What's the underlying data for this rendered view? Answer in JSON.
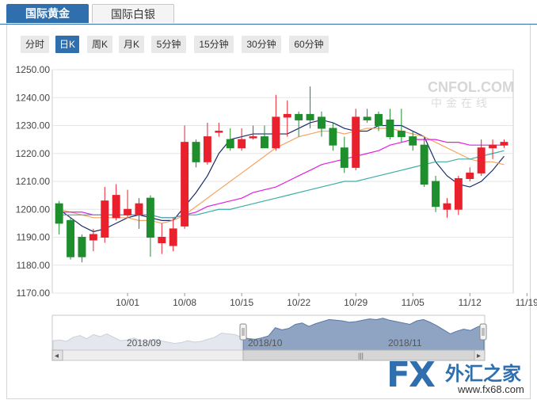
{
  "tabs": [
    {
      "label": "国际黄金",
      "active": true
    },
    {
      "label": "国际白银",
      "active": false
    }
  ],
  "periods": [
    {
      "label": "分时",
      "active": false
    },
    {
      "label": "日K",
      "active": true
    },
    {
      "label": "周K",
      "active": false
    },
    {
      "label": "月K",
      "active": false
    },
    {
      "label": "5分钟",
      "active": false
    },
    {
      "label": "15分钟",
      "active": false
    },
    {
      "label": "30分钟",
      "active": false
    },
    {
      "label": "60分钟",
      "active": false
    }
  ],
  "watermark": {
    "brand": "CNFOL.COM",
    "brand_cn": "中金在线"
  },
  "logo": {
    "fx": "FX",
    "cn": "外汇之家",
    "url": "www.fx68.com"
  },
  "navigator": {
    "labels": [
      "2018/09",
      "2018/10",
      "2018/11"
    ],
    "left_arrow": "◂",
    "right_arrow": "▸",
    "grip": "|||"
  },
  "colors": {
    "up": "#e8212d",
    "down": "#1f8e2d",
    "ma5": "#1c2a6b",
    "ma10": "#f4a460",
    "ma20": "#e020e0",
    "ma30": "#3aaea8",
    "accent": "#2f6fae"
  },
  "chart_data": {
    "type": "candlestick",
    "title": "",
    "ylim": [
      1170,
      1250
    ],
    "y_ticks": [
      1250.0,
      1240.0,
      1230.0,
      1220.0,
      1210.0,
      1200.0,
      1190.0,
      1180.0,
      1170.0
    ],
    "x_tick_labels": [
      "10/01",
      "10/08",
      "10/15",
      "10/22",
      "10/29",
      "11/05",
      "11/12",
      "11/19"
    ],
    "x_tick_index": [
      6,
      11,
      16,
      21,
      26,
      31,
      36,
      41
    ],
    "candles": [
      {
        "o": 1202,
        "h": 1203,
        "l": 1191,
        "c": 1195
      },
      {
        "o": 1196,
        "h": 1197,
        "l": 1182,
        "c": 1183
      },
      {
        "o": 1190,
        "h": 1191,
        "l": 1181,
        "c": 1183
      },
      {
        "o": 1189,
        "h": 1193,
        "l": 1185,
        "c": 1191
      },
      {
        "o": 1190,
        "h": 1208,
        "l": 1188,
        "c": 1203
      },
      {
        "o": 1197,
        "h": 1209,
        "l": 1196,
        "c": 1205
      },
      {
        "o": 1198,
        "h": 1207,
        "l": 1197,
        "c": 1200
      },
      {
        "o": 1198,
        "h": 1204,
        "l": 1193,
        "c": 1202
      },
      {
        "o": 1204,
        "h": 1205,
        "l": 1183,
        "c": 1190
      },
      {
        "o": 1188,
        "h": 1195,
        "l": 1184,
        "c": 1190
      },
      {
        "o": 1187,
        "h": 1197,
        "l": 1185,
        "c": 1193
      },
      {
        "o": 1194,
        "h": 1230,
        "l": 1193,
        "c": 1224
      },
      {
        "o": 1224,
        "h": 1225,
        "l": 1215,
        "c": 1217
      },
      {
        "o": 1217,
        "h": 1231,
        "l": 1216,
        "c": 1226
      },
      {
        "o": 1228,
        "h": 1231,
        "l": 1226,
        "c": 1228
      },
      {
        "o": 1225,
        "h": 1229,
        "l": 1221,
        "c": 1222
      },
      {
        "o": 1222,
        "h": 1229,
        "l": 1221,
        "c": 1225
      },
      {
        "o": 1226,
        "h": 1230,
        "l": 1225,
        "c": 1226
      },
      {
        "o": 1226,
        "h": 1230,
        "l": 1222,
        "c": 1222
      },
      {
        "o": 1222,
        "h": 1241,
        "l": 1221,
        "c": 1233
      },
      {
        "o": 1233,
        "h": 1239,
        "l": 1226,
        "c": 1234
      },
      {
        "o": 1234,
        "h": 1235,
        "l": 1226,
        "c": 1232
      },
      {
        "o": 1234,
        "h": 1244,
        "l": 1229,
        "c": 1232
      },
      {
        "o": 1233,
        "h": 1235,
        "l": 1226,
        "c": 1229
      },
      {
        "o": 1229,
        "h": 1231,
        "l": 1221,
        "c": 1223
      },
      {
        "o": 1222,
        "h": 1226,
        "l": 1213,
        "c": 1215
      },
      {
        "o": 1215,
        "h": 1236,
        "l": 1214,
        "c": 1233
      },
      {
        "o": 1233,
        "h": 1236,
        "l": 1231,
        "c": 1232
      },
      {
        "o": 1234,
        "h": 1235,
        "l": 1228,
        "c": 1230
      },
      {
        "o": 1232,
        "h": 1236,
        "l": 1225,
        "c": 1226
      },
      {
        "o": 1228,
        "h": 1236,
        "l": 1224,
        "c": 1226
      },
      {
        "o": 1226,
        "h": 1228,
        "l": 1221,
        "c": 1223
      },
      {
        "o": 1223,
        "h": 1226,
        "l": 1208,
        "c": 1209
      },
      {
        "o": 1210,
        "h": 1212,
        "l": 1199,
        "c": 1201
      },
      {
        "o": 1200,
        "h": 1204,
        "l": 1197,
        "c": 1202
      },
      {
        "o": 1200,
        "h": 1212,
        "l": 1198,
        "c": 1211
      },
      {
        "o": 1211,
        "h": 1215,
        "l": 1210,
        "c": 1213
      },
      {
        "o": 1213,
        "h": 1225,
        "l": 1212,
        "c": 1222
      },
      {
        "o": 1222,
        "h": 1225,
        "l": 1218,
        "c": 1223
      },
      {
        "o": 1223,
        "h": 1225,
        "l": 1222,
        "c": 1224
      }
    ],
    "ma_series": [
      {
        "key": "ma5",
        "values": [
          1200,
          1197,
          1194,
          1192,
          1193,
          1195,
          1197,
          1198,
          1197,
          1196,
          1196,
          1201,
          1206,
          1212,
          1220,
          1225,
          1226,
          1227,
          1227,
          1227,
          1227,
          1229,
          1231,
          1232,
          1231,
          1229,
          1228,
          1228,
          1230,
          1230,
          1230,
          1228,
          1226,
          1217,
          1212,
          1209,
          1208,
          1210,
          1214,
          1219
        ]
      },
      {
        "key": "ma10",
        "values": [
          1200,
          1199,
          1198,
          1197,
          1197,
          1197,
          1197,
          1196,
          1196,
          1195,
          1196,
          1198,
          1201,
          1204,
          1207,
          1210,
          1213,
          1216,
          1219,
          1222,
          1224,
          1226,
          1227,
          1228,
          1228,
          1227,
          1228,
          1229,
          1229,
          1229,
          1228,
          1227,
          1226,
          1224,
          1222,
          1220,
          1218,
          1217,
          1217,
          1216
        ]
      },
      {
        "key": "ma20",
        "values": [
          1199,
          1199,
          1199,
          1198,
          1198,
          1198,
          1198,
          1198,
          1198,
          1197,
          1197,
          1198,
          1199,
          1201,
          1202,
          1203,
          1204,
          1206,
          1207,
          1208,
          1210,
          1212,
          1214,
          1216,
          1217,
          1218,
          1219,
          1220,
          1221,
          1223,
          1224,
          1225,
          1225,
          1225,
          1224,
          1224,
          1223,
          1223,
          1223,
          1223
        ]
      },
      {
        "key": "ma30",
        "values": [
          1198,
          1198,
          1198,
          1198,
          1198,
          1198,
          1198,
          1198,
          1198,
          1197,
          1197,
          1198,
          1198,
          1199,
          1200,
          1200,
          1201,
          1202,
          1203,
          1204,
          1205,
          1206,
          1207,
          1208,
          1209,
          1210,
          1210,
          1211,
          1212,
          1213,
          1214,
          1215,
          1216,
          1217,
          1217,
          1218,
          1218,
          1219,
          1220,
          1221
        ]
      }
    ],
    "navigator_series": [
      0.3,
      0.32,
      0.28,
      0.4,
      0.45,
      0.36,
      0.48,
      0.42,
      0.5,
      0.4,
      0.3,
      0.32,
      0.38,
      0.3,
      0.28,
      0.34,
      0.3,
      0.26,
      0.22,
      0.24,
      0.3,
      0.26,
      0.28,
      0.34,
      0.4,
      0.52,
      0.5,
      0.48,
      0.4,
      0.36,
      0.34,
      0.38,
      0.44,
      0.68,
      0.62,
      0.66,
      0.78,
      0.82,
      0.72,
      0.8,
      0.86,
      0.92,
      0.9,
      0.88,
      0.84,
      0.86,
      0.9,
      0.94,
      0.92,
      0.96,
      0.9,
      0.86,
      0.82,
      0.78,
      0.88,
      0.92,
      0.84,
      0.74,
      0.62,
      0.5,
      0.58,
      0.64,
      0.6,
      0.7,
      0.78
    ]
  }
}
